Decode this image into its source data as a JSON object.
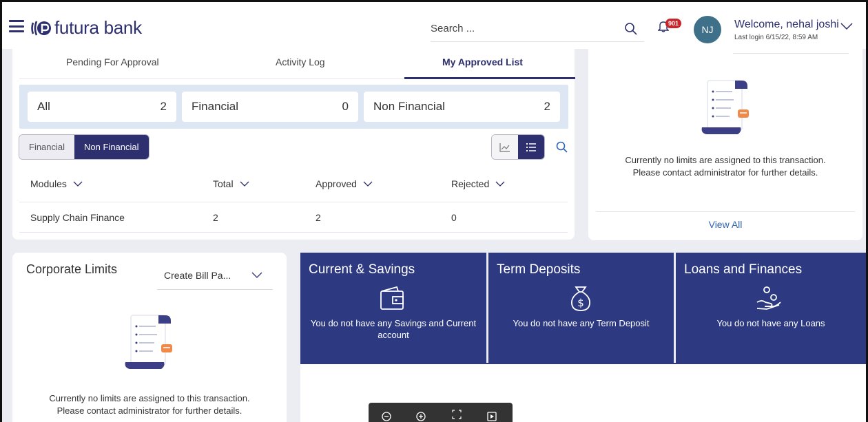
{
  "header": {
    "brand": "futura bank",
    "search_placeholder": "Search ...",
    "notification_count": "901",
    "avatar_initials": "NJ",
    "welcome": "Welcome, nehal joshi",
    "last_login": "Last login 6/15/22, 8:59 AM"
  },
  "approvals": {
    "tabs": [
      {
        "label": "Pending For Approval",
        "active": false
      },
      {
        "label": "Activity Log",
        "active": false
      },
      {
        "label": "My Approved List",
        "active": true
      }
    ],
    "summary": [
      {
        "label": "All",
        "count": "2"
      },
      {
        "label": "Financial",
        "count": "0"
      },
      {
        "label": "Non Financial",
        "count": "2"
      }
    ],
    "toggle": {
      "financial": "Financial",
      "non_financial": "Non Financial"
    },
    "columns": [
      "Modules",
      "Total",
      "Approved",
      "Rejected"
    ],
    "rows": [
      {
        "module": "Supply Chain Finance",
        "total": "2",
        "approved": "2",
        "rejected": "0"
      }
    ]
  },
  "limits_panel": {
    "message_line1": "Currently no limits are assigned to this transaction.",
    "message_line2": "Please contact administrator for further details.",
    "view_all": "View All"
  },
  "corporate_limits": {
    "title": "Corporate Limits",
    "selected": "Create Bill Pa...",
    "message_line1": "Currently no limits are assigned to this transaction.",
    "message_line2": "Please contact administrator for further details."
  },
  "accounts": [
    {
      "title": "Current & Savings",
      "icon": "wallet-icon",
      "message": "You do not have any Savings and Current account"
    },
    {
      "title": "Term Deposits",
      "icon": "money-bag-icon",
      "message": "You do not have any Term Deposit"
    },
    {
      "title": "Loans and Finances",
      "icon": "hand-coins-icon",
      "message": "You do not have any Loans"
    }
  ],
  "colors": {
    "brand": "#2d2f6e",
    "account_tile": "#2d3a82",
    "summary_bg": "#dde7f3",
    "badge": "#c9262b",
    "link": "#2d63b0"
  }
}
